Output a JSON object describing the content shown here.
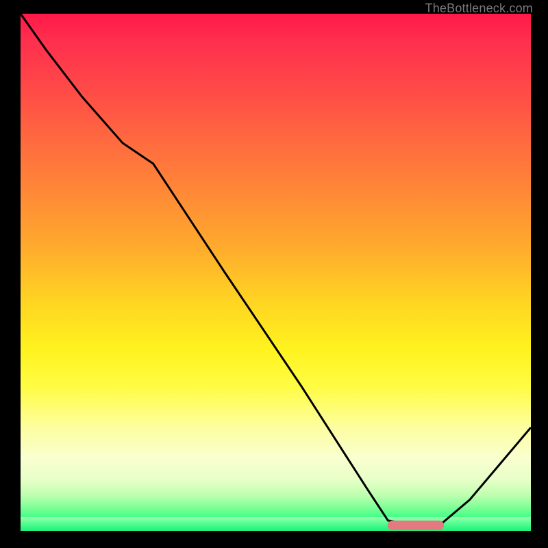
{
  "domain": "Chart",
  "watermark": "TheBottleneck.com",
  "colors": {
    "curve": "#000000",
    "marker": "#e47a7f",
    "gradient_top": "#ff1948",
    "gradient_bottom": "#1fef7a"
  },
  "chart_data": {
    "type": "line",
    "title": "",
    "xlabel": "",
    "ylabel": "",
    "xlim": [
      0,
      100
    ],
    "ylim": [
      0,
      100
    ],
    "grid": false,
    "series": [
      {
        "name": "bottleneck-curve",
        "x": [
          0,
          5,
          12,
          20,
          26,
          40,
          55,
          68,
          72,
          78,
          82,
          88,
          94,
          100
        ],
        "values": [
          100,
          93,
          84,
          75,
          71,
          50,
          28,
          8,
          2,
          1,
          1,
          6,
          13,
          20
        ]
      }
    ],
    "optimum_band": {
      "x_start": 72,
      "x_end": 83,
      "y": 1
    },
    "annotations": []
  }
}
